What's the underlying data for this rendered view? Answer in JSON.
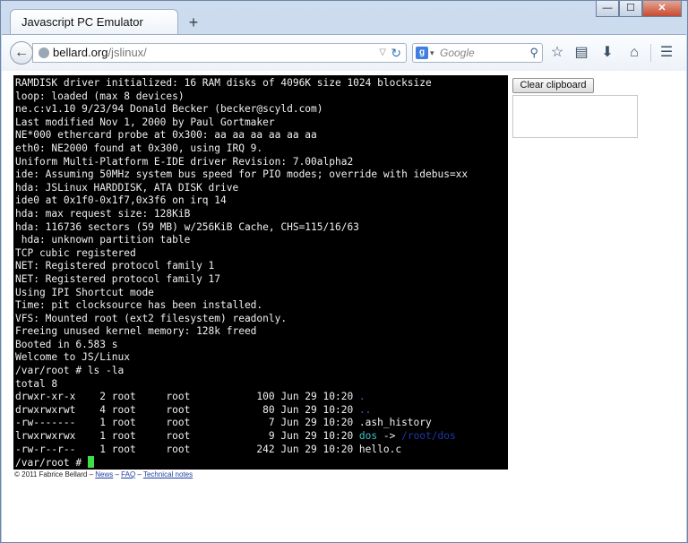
{
  "browser": {
    "tab_title": "Javascript PC Emulator",
    "new_tab": "+",
    "window_buttons": {
      "minimize": "—",
      "maximize": "☐",
      "close": "✕"
    },
    "back": "←",
    "url_host": "bellard.org",
    "url_path": "/jslinux/",
    "search_engine_letter": "g",
    "search_placeholder": "Google",
    "icons": [
      "bookmark-star-icon",
      "reading-list-icon",
      "download-icon",
      "home-icon",
      "menu-icon"
    ]
  },
  "terminal": {
    "lines": [
      "RAMDISK driver initialized: 16 RAM disks of 4096K size 1024 blocksize",
      "loop: loaded (max 8 devices)",
      "ne.c:v1.10 9/23/94 Donald Becker (becker@scyld.com)",
      "Last modified Nov 1, 2000 by Paul Gortmaker",
      "NE*000 ethercard probe at 0x300: aa aa aa aa aa aa",
      "eth0: NE2000 found at 0x300, using IRQ 9.",
      "Uniform Multi-Platform E-IDE driver Revision: 7.00alpha2",
      "ide: Assuming 50MHz system bus speed for PIO modes; override with idebus=xx",
      "hda: JSLinux HARDDISK, ATA DISK drive",
      "ide0 at 0x1f0-0x1f7,0x3f6 on irq 14",
      "hda: max request size: 128KiB",
      "hda: 116736 sectors (59 MB) w/256KiB Cache, CHS=115/16/63",
      " hda: unknown partition table",
      "TCP cubic registered",
      "NET: Registered protocol family 1",
      "NET: Registered protocol family 17",
      "Using IPI Shortcut mode",
      "Time: pit clocksource has been installed.",
      "VFS: Mounted root (ext2 filesystem) readonly.",
      "Freeing unused kernel memory: 128k freed",
      "Booted in 6.583 s",
      "Welcome to JS/Linux",
      "/var/root # ls -la",
      "total 8"
    ],
    "listing": [
      {
        "prefix": "drwxr-xr-x    2 root     root           100 Jun 29 10:20 ",
        "name": ".",
        "name_color": "blue",
        "target": ""
      },
      {
        "prefix": "drwxrwxrwt    4 root     root            80 Jun 29 10:20 ",
        "name": "..",
        "name_color": "blue",
        "target": ""
      },
      {
        "prefix": "-rw-------    1 root     root             7 Jun 29 10:20 ",
        "name": ".ash_history",
        "name_color": "white",
        "target": ""
      },
      {
        "prefix": "lrwxrwxrwx    1 root     root             9 Jun 29 10:20 ",
        "name": "dos",
        "name_color": "cyan",
        "arrow": " -> ",
        "target": "/root/dos"
      },
      {
        "prefix": "-rw-r--r--    1 root     root           242 Jun 29 10:20 ",
        "name": "hello.c",
        "name_color": "white",
        "target": ""
      }
    ],
    "prompt": "/var/root # "
  },
  "sidebar": {
    "clear_button": "Clear clipboard",
    "clipboard_value": ""
  },
  "footer": {
    "copyright": "© 2011 Fabrice Bellard – ",
    "link_news": "News",
    "sep1": " – ",
    "link_faq": "FAQ",
    "sep2": " – ",
    "link_notes": "Technical notes"
  }
}
